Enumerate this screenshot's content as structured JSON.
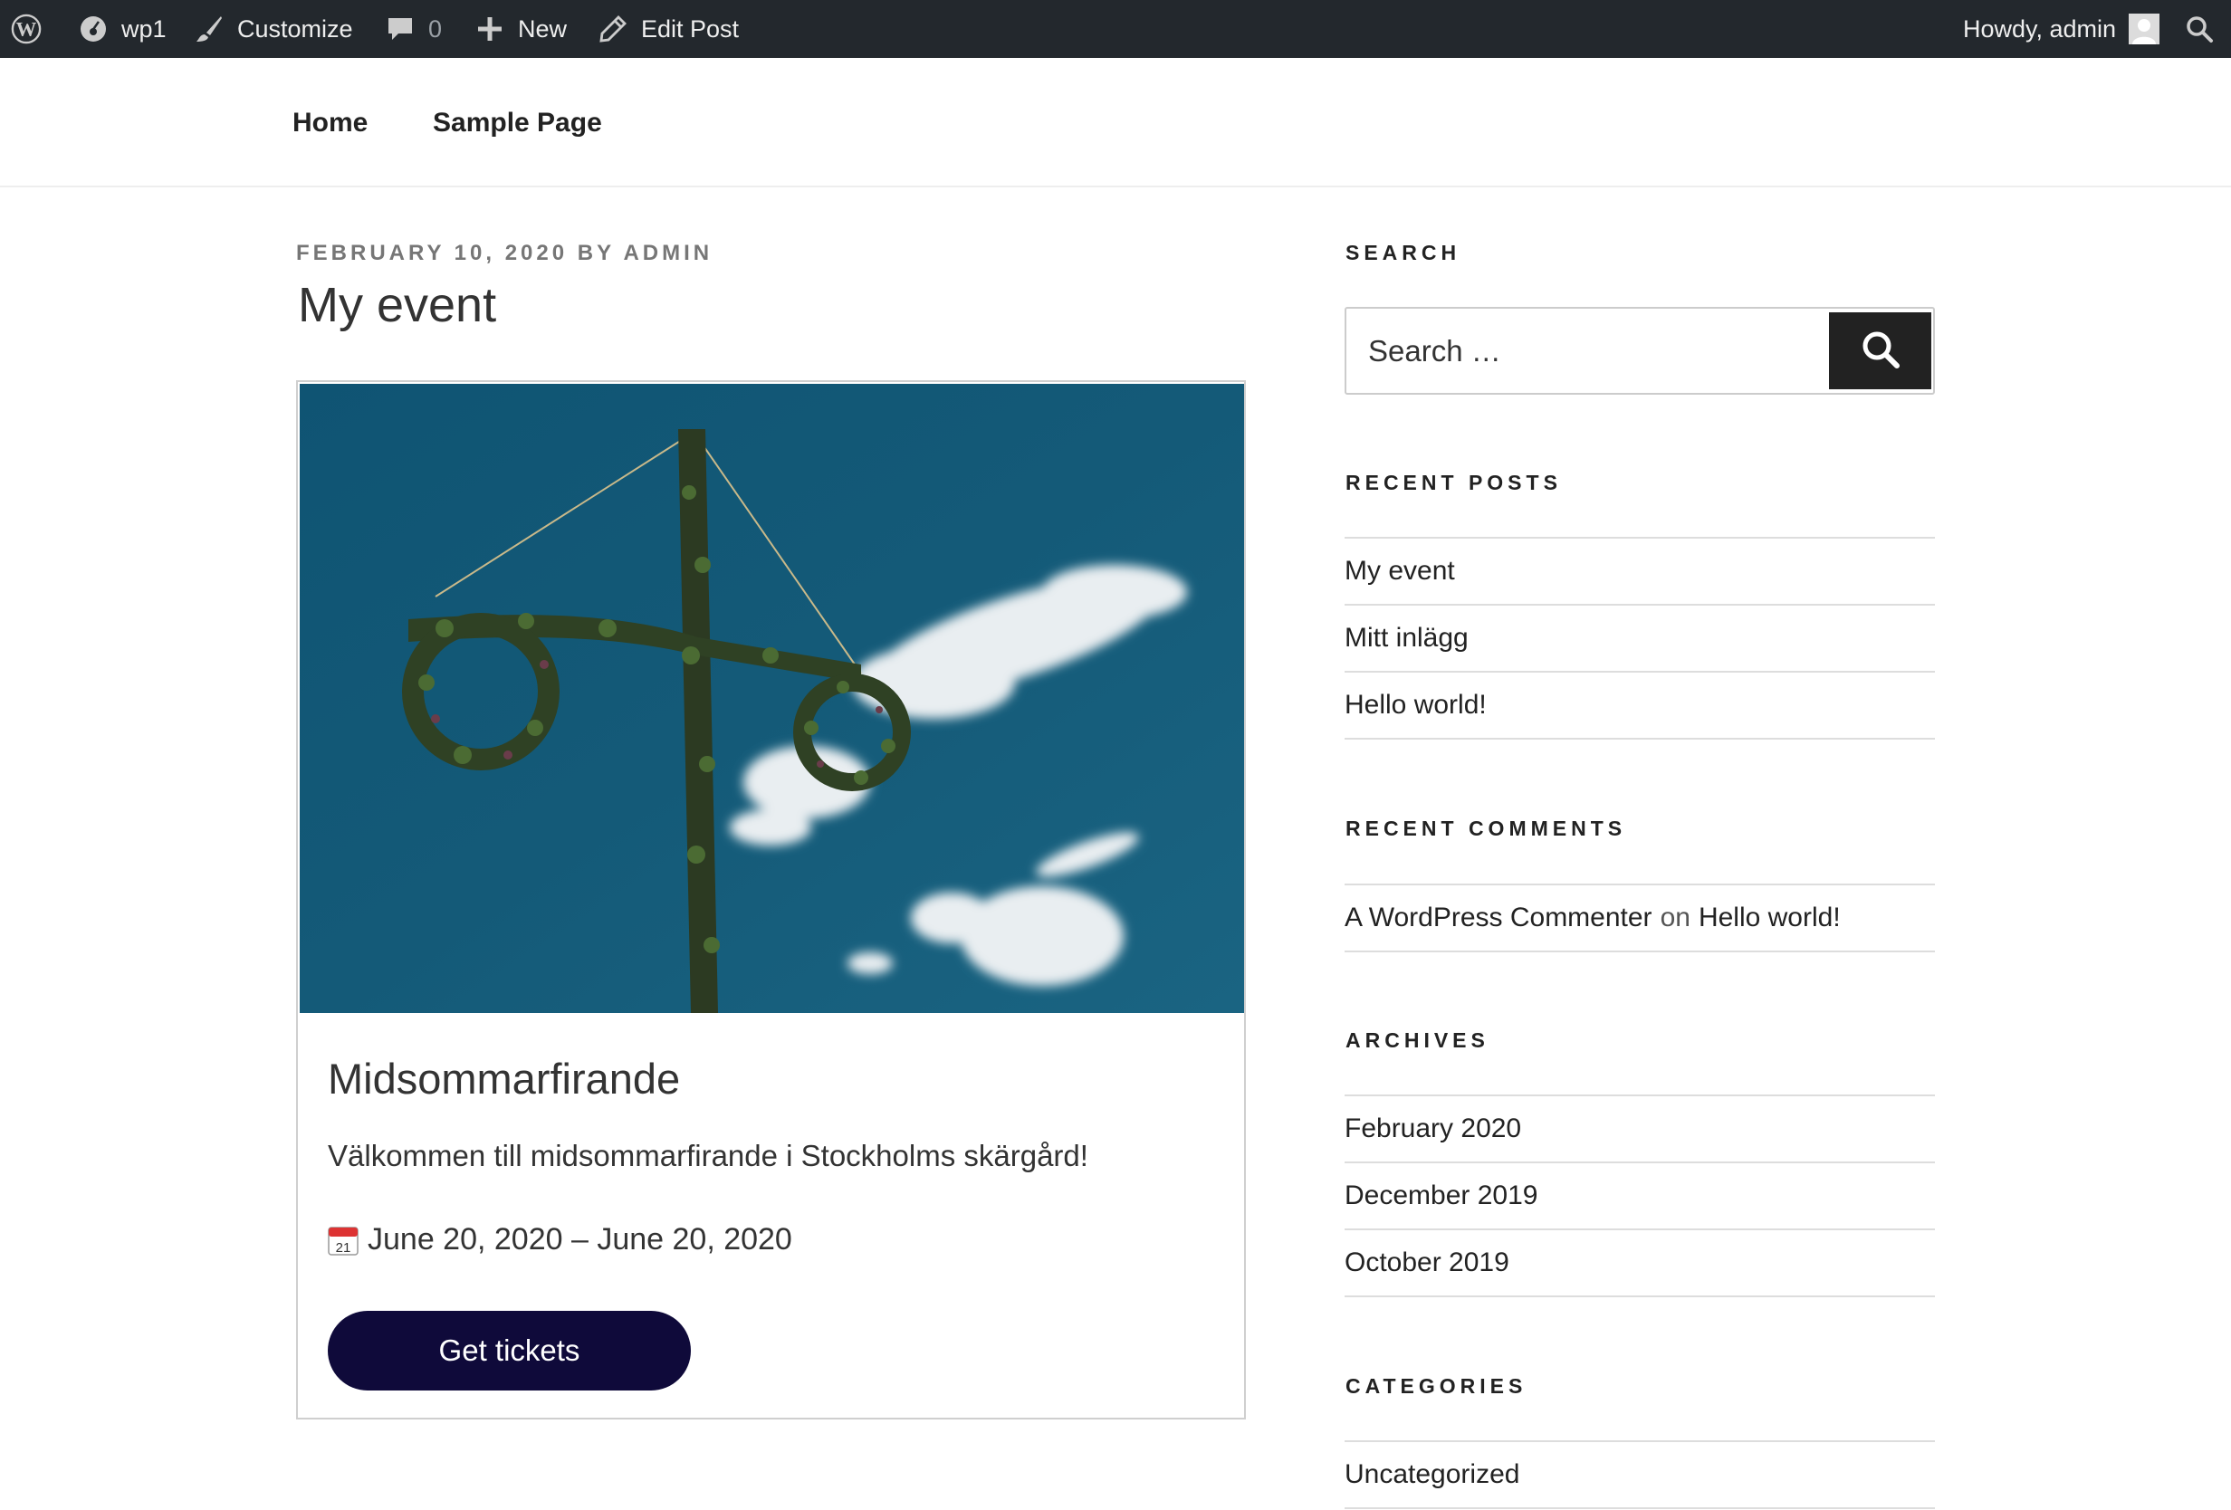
{
  "admin_bar": {
    "site_name": "wp1",
    "customize": "Customize",
    "comments_count": "0",
    "new": "New",
    "edit_post": "Edit Post",
    "howdy": "Howdy, admin"
  },
  "nav": {
    "items": [
      {
        "label": "Home"
      },
      {
        "label": "Sample Page"
      }
    ]
  },
  "post": {
    "meta": "FEBRUARY 10, 2020 BY ADMIN",
    "title": "My event",
    "event": {
      "name": "Midsommarfirande",
      "description": "Välkommen till midsommarfirande i Stockholms skärgård!",
      "calendar_icon_text": "21",
      "date_range": "June 20, 2020 – June 20, 2020",
      "button": "Get tickets"
    }
  },
  "sidebar": {
    "search": {
      "title": "SEARCH",
      "placeholder": "Search …"
    },
    "recent_posts": {
      "title": "RECENT POSTS",
      "items": [
        "My event",
        "Mitt inlägg",
        "Hello world!"
      ]
    },
    "recent_comments": {
      "title": "RECENT COMMENTS",
      "items": [
        {
          "author": "A WordPress Commenter",
          "connector": "on",
          "post": "Hello world!"
        }
      ]
    },
    "archives": {
      "title": "ARCHIVES",
      "items": [
        "February 2020",
        "December 2019",
        "October 2019"
      ]
    },
    "categories": {
      "title": "CATEGORIES",
      "items": [
        "Uncategorized"
      ]
    }
  },
  "colors": {
    "admin_bar_bg": "#23282d",
    "button_bg": "#0f0a3a",
    "sky": "#145a78"
  }
}
